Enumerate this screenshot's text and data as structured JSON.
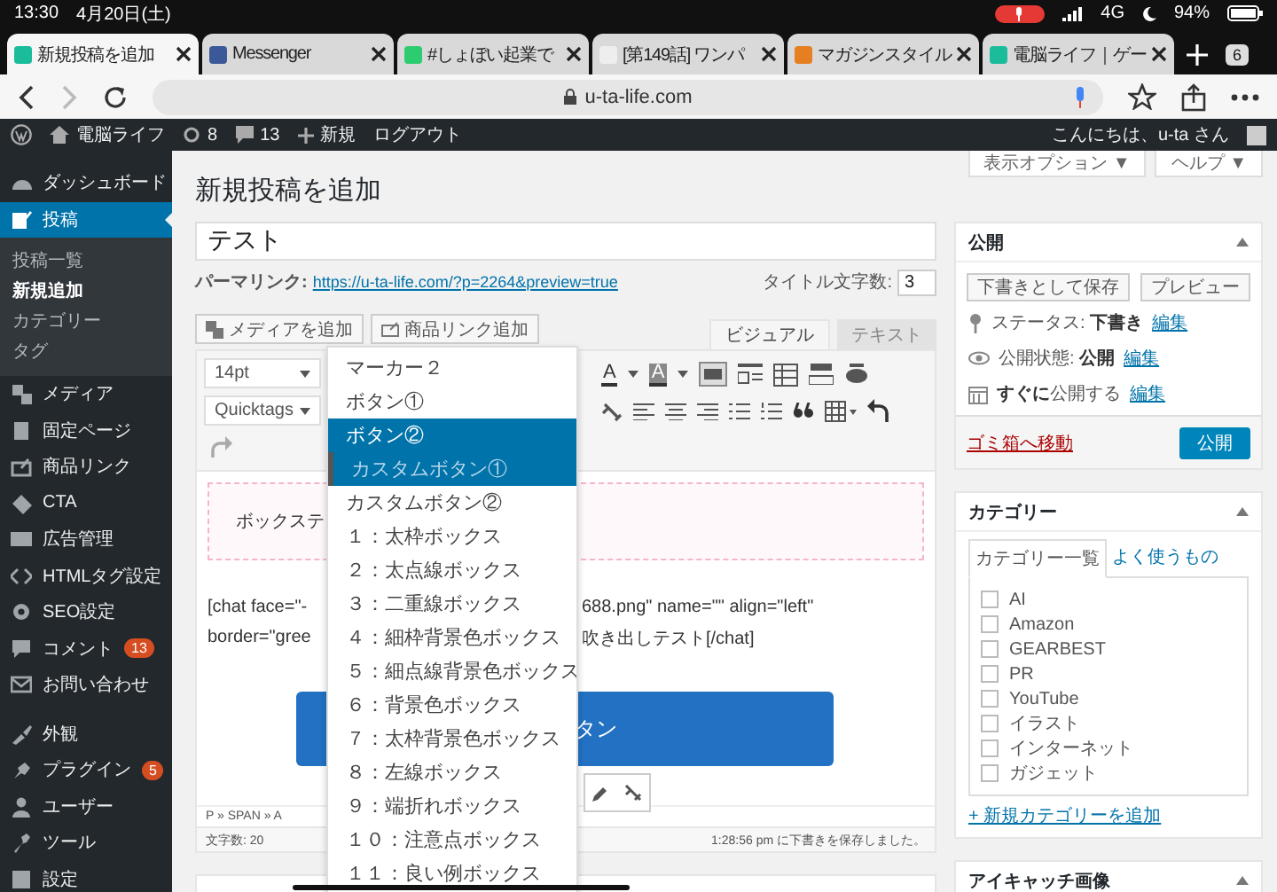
{
  "status_bar": {
    "time": "13:30",
    "date": "4月20日(土)",
    "network": "4G",
    "battery": "94%"
  },
  "browser_tabs": [
    {
      "title": "新規投稿を追加",
      "selected": true
    },
    {
      "title": "Messenger",
      "selected": false
    },
    {
      "title": "#しょぼい起業で",
      "selected": false
    },
    {
      "title": "[第149話] ワンパ",
      "selected": false
    },
    {
      "title": "マガジンスタイル",
      "selected": false
    },
    {
      "title": "電脳ライフ｜ゲー",
      "selected": false
    }
  ],
  "tab_count": "6",
  "address_bar": {
    "url": "u-ta-life.com"
  },
  "admin_bar": {
    "site": "電脳ライフ",
    "updates": "8",
    "comments": "13",
    "new": "新規",
    "logout": "ログアウト",
    "greeting": "こんにちは、u-ta さん"
  },
  "sidebar": {
    "groups": [
      {
        "items": [
          {
            "label": "ダッシュボード",
            "selected": false
          },
          {
            "label": "投稿",
            "selected": true,
            "children": [
              {
                "label": "投稿一覧",
                "selected": false
              },
              {
                "label": "新規追加",
                "selected": true
              },
              {
                "label": "カテゴリー",
                "selected": false
              },
              {
                "label": "タグ",
                "selected": false
              }
            ]
          },
          {
            "label": "メディア",
            "selected": false
          },
          {
            "label": "固定ページ",
            "selected": false
          },
          {
            "label": "商品リンク",
            "selected": false
          },
          {
            "label": "CTA",
            "selected": false
          },
          {
            "label": "広告管理",
            "selected": false
          },
          {
            "label": "HTMLタグ設定",
            "selected": false
          },
          {
            "label": "SEO設定",
            "selected": false
          },
          {
            "label": "コメント",
            "selected": false,
            "badge": "13"
          },
          {
            "label": "お問い合わせ",
            "selected": false
          }
        ]
      },
      {
        "items": [
          {
            "label": "外観",
            "selected": false
          },
          {
            "label": "プラグイン",
            "selected": false,
            "badge": "5"
          },
          {
            "label": "ユーザー",
            "selected": false
          },
          {
            "label": "ツール",
            "selected": false
          },
          {
            "label": "設定",
            "selected": false
          }
        ]
      }
    ]
  },
  "screen_options": "表示オプション ▼",
  "help": "ヘルプ ▼",
  "editor": {
    "heading": "新規投稿を追加",
    "title": "テスト",
    "permalink_label": "パーマリンク:",
    "permalink": "https://u-ta-life.com/?p=2264&preview=true",
    "title_count_label": "タイトル文字数:",
    "title_count": "3",
    "media_buttons": [
      "メディアを追加",
      "商品リンク追加"
    ],
    "mode_tabs": [
      {
        "label": "ビジュアル",
        "selected": true
      },
      {
        "label": "テキスト",
        "selected": false
      }
    ],
    "font_size": "14pt",
    "quicktags": "Quicktags",
    "font_color_glyph": "A",
    "highlight_glyph": "A",
    "box_text": "ボックステ",
    "chat_line1_left": "[chat face=\"-",
    "chat_line1_right": "688.png\" name=\"\" align=\"left\"",
    "chat_line2_left": "border=\"gree",
    "chat_line2_right": "吹き出しテスト[/chat]",
    "button_text": "タン",
    "path": "P » SPAN » A",
    "word_count": "文字数: 20",
    "saved_note": "1:28:56 pm に下書きを保存しました。"
  },
  "style_dropdown": {
    "items": [
      {
        "label": "マーカー２",
        "kind": "plain",
        "selected": false
      },
      {
        "label": "ボタン①",
        "kind": "plain",
        "selected": false
      },
      {
        "label": "ボタン②",
        "kind": "button",
        "selected": false
      },
      {
        "label": "カスタムボタン①",
        "kind": "custom_button",
        "selected": false
      },
      {
        "label": "カスタムボタン②",
        "kind": "plain",
        "selected": false
      },
      {
        "label": "１：太枠ボックス",
        "kind": "plain",
        "selected": false
      },
      {
        "label": "２：太点線ボックス",
        "kind": "plain",
        "selected": false
      },
      {
        "label": "３：二重線ボックス",
        "kind": "plain",
        "selected": false
      },
      {
        "label": "４：細枠背景色ボックス",
        "kind": "plain",
        "selected": false
      },
      {
        "label": "５：細点線背景色ボックス",
        "kind": "plain",
        "selected": false
      },
      {
        "label": "６：背景色ボックス",
        "kind": "plain",
        "selected": false
      },
      {
        "label": "７：太枠背景色ボックス",
        "kind": "plain",
        "selected": false
      },
      {
        "label": "８：左線ボックス",
        "kind": "plain",
        "selected": false
      },
      {
        "label": "９：端折れボックス",
        "kind": "plain",
        "selected": false
      },
      {
        "label": "１０：注意点ボックス",
        "kind": "plain",
        "selected": false
      },
      {
        "label": "１１：良い例ボックス",
        "kind": "plain",
        "selected": false
      }
    ]
  },
  "publish_box": {
    "title": "公開",
    "save_draft": "下書きとして保存",
    "preview": "プレビュー",
    "rows": [
      {
        "text": "ステータス: **下書き**",
        "link": "編集"
      },
      {
        "text": "公開状態: **公開**",
        "link": "編集"
      },
      {
        "text": "**すぐに**公開する",
        "link": "編集"
      }
    ],
    "trash": "ゴミ箱へ移動",
    "publish": "公開"
  },
  "category_box": {
    "title": "カテゴリー",
    "tabs": [
      {
        "label": "カテゴリー一覧",
        "selected": true
      },
      {
        "label": "よく使うもの",
        "selected": false
      }
    ],
    "items": [
      {
        "label": "AI",
        "checked": false
      },
      {
        "label": "Amazon",
        "checked": false
      },
      {
        "label": "GEARBEST",
        "checked": false
      },
      {
        "label": "PR",
        "checked": false
      },
      {
        "label": "YouTube",
        "checked": false
      },
      {
        "label": "イラスト",
        "checked": false
      },
      {
        "label": "インターネット",
        "checked": false
      },
      {
        "label": "ガジェット",
        "checked": false
      }
    ],
    "add_link": "+ 新規カテゴリーを追加"
  },
  "featured_image": {
    "title": "アイキャッチ画像"
  }
}
